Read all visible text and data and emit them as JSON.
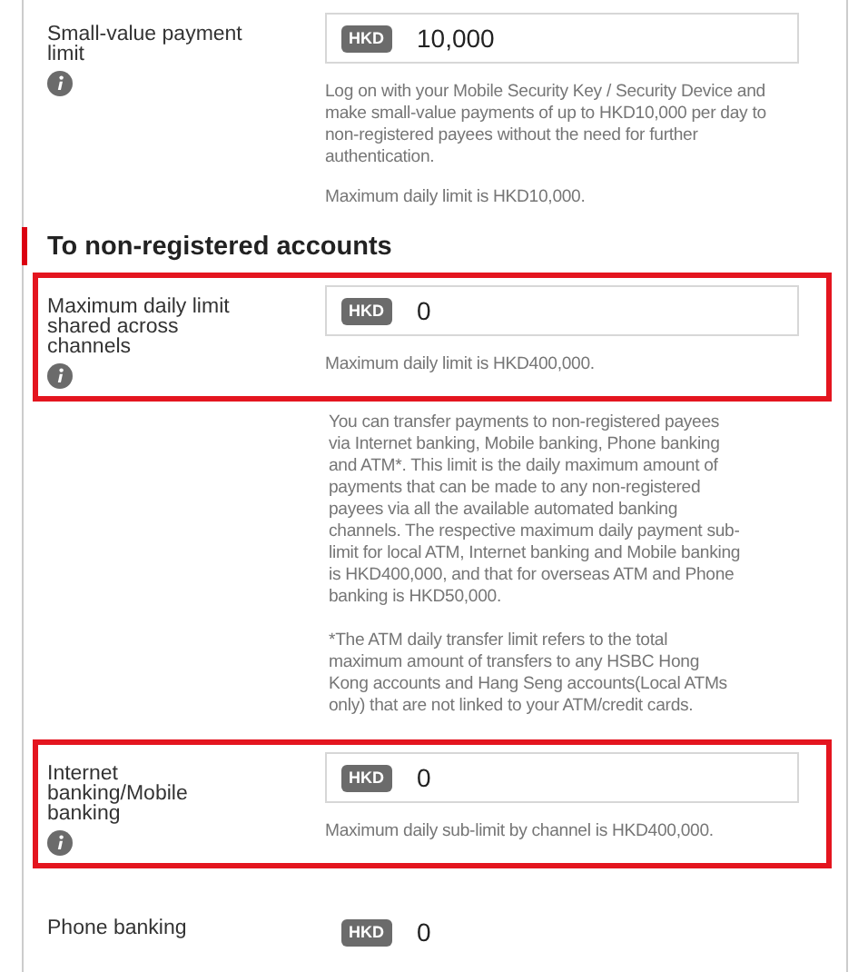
{
  "items": [
    {
      "kind": "limit",
      "label": "Small-value payment limit",
      "info": true,
      "highlighted": false,
      "boxed": true,
      "currency": "HKD",
      "value": "10,000",
      "hints": [
        "Log on with your Mobile Security Key / Security Device and make small-value payments of up to HKD10,000 per day to non-registered payees without the need for further authentication.",
        "Maximum daily limit is HKD10,000."
      ]
    },
    {
      "kind": "heading",
      "text": "To non-registered accounts"
    },
    {
      "kind": "limit",
      "label": "Maximum daily limit shared across channels",
      "info": true,
      "highlighted": true,
      "boxed": true,
      "currency": "HKD",
      "value": "0",
      "hints": [
        "Maximum daily limit is HKD400,000."
      ]
    },
    {
      "kind": "note",
      "paragraphs": [
        "You can transfer payments to non-registered payees via Internet banking, Mobile banking, Phone banking and ATM*. This limit is the daily maximum amount of payments that can be made to any non-registered payees via all the available automated banking channels. The respective maximum daily payment sub-limit for local ATM, Internet banking and Mobile banking is HKD400,000, and that for overseas ATM and Phone banking is HKD50,000.",
        "*The ATM daily transfer limit refers to the total maximum amount of transfers to any HSBC Hong Kong accounts and Hang Seng accounts(Local ATMs only) that are not linked to your ATM/credit cards."
      ]
    },
    {
      "kind": "limit",
      "label": "Internet banking/Mobile banking",
      "info": true,
      "highlighted": true,
      "boxed": true,
      "currency": "HKD",
      "value": "0",
      "hints": [
        "Maximum daily sub-limit by channel is HKD400,000."
      ]
    },
    {
      "kind": "limit",
      "label": "Phone banking",
      "info": false,
      "highlighted": false,
      "boxed": false,
      "currency": "HKD",
      "value": "0"
    }
  ]
}
